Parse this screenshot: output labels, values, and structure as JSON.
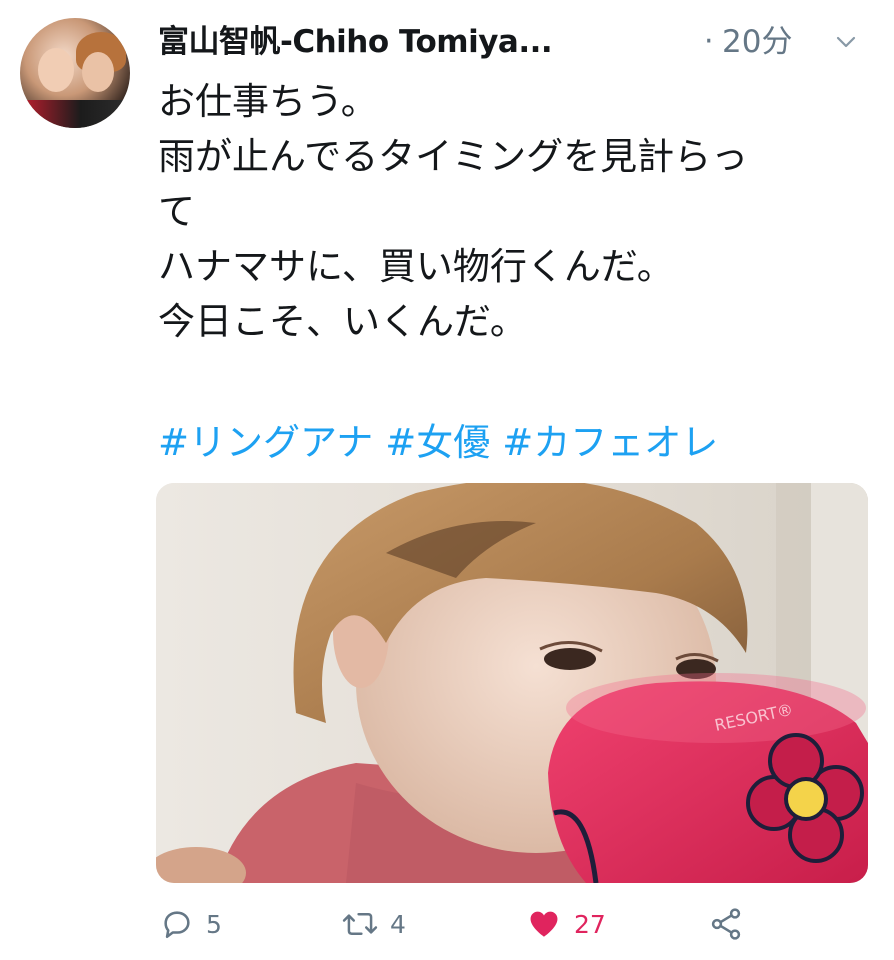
{
  "tweet": {
    "author_name": "富山智帆-Chiho Tomiya...",
    "separator": "·",
    "time": "20分",
    "text_lines": [
      "お仕事ちう。",
      "雨が止んでるタイミングを見計らっ",
      "て",
      "ハナマサに、買い物行くんだ。",
      "今日こそ、いくんだ。"
    ],
    "hashtags": [
      "#リングアナ",
      "#女優",
      "#カフェオレ"
    ],
    "mug_print": "RESORT®"
  },
  "actions": {
    "reply_count": "5",
    "retweet_count": "4",
    "like_count": "27"
  },
  "colors": {
    "link": "#1da1f2",
    "muted": "#657786",
    "like": "#e0245e"
  },
  "icons": {
    "reply": "reply-icon",
    "retweet": "retweet-icon",
    "like": "heart-icon",
    "share": "share-icon",
    "menu": "chevron-down-icon"
  }
}
